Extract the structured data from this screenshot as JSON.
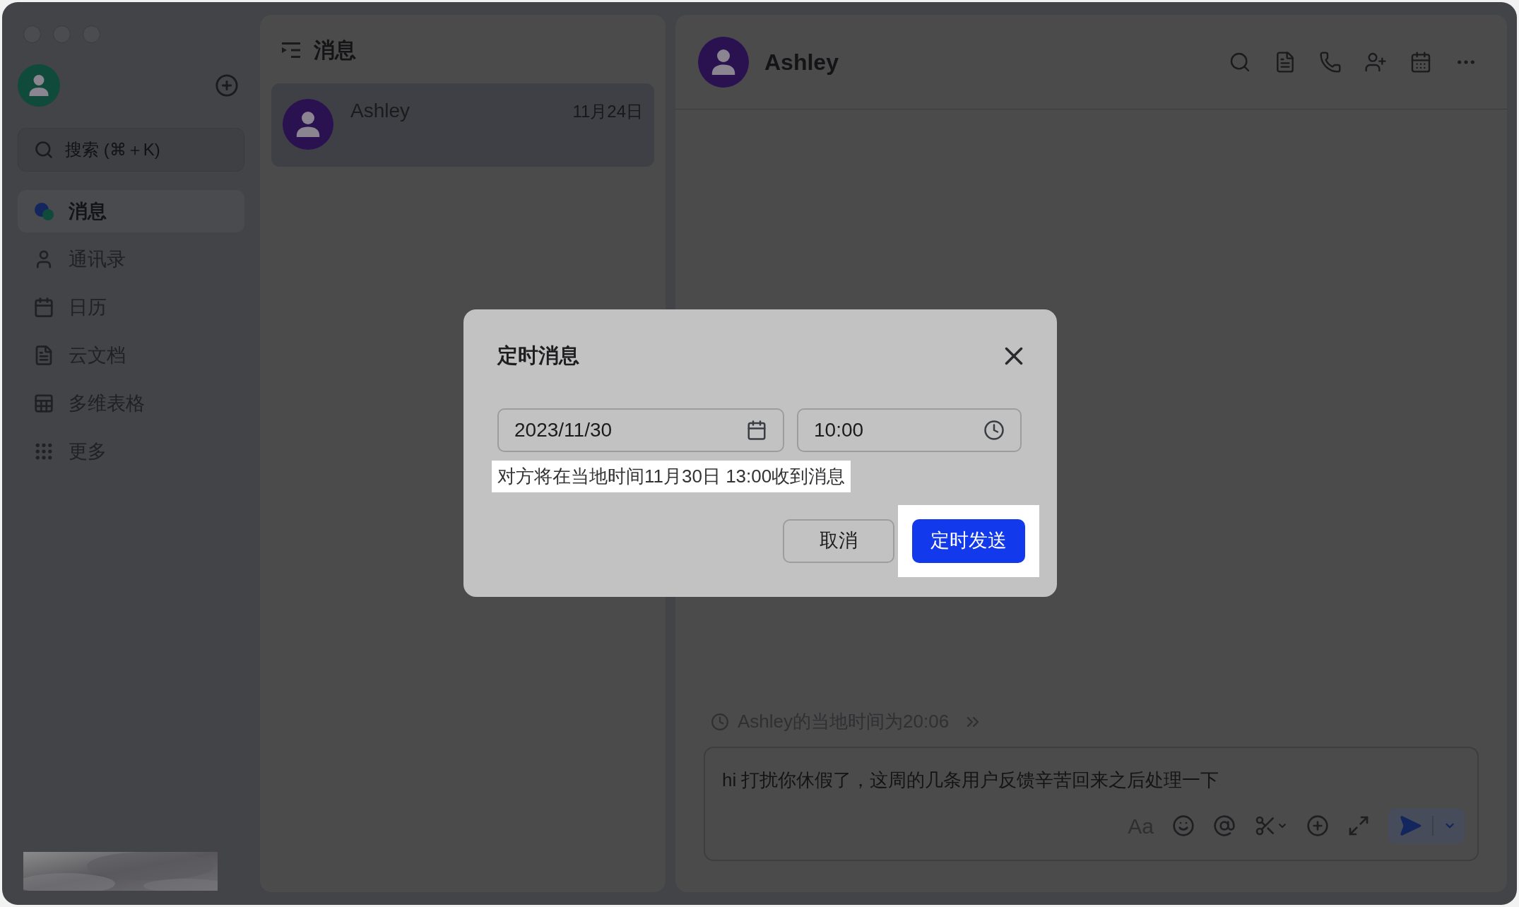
{
  "sidebar": {
    "search": {
      "placeholder": "搜索 (⌘＋K)"
    },
    "items": [
      {
        "label": "消息",
        "kind": "messages",
        "selected": true
      },
      {
        "label": "通讯录",
        "kind": "contacts",
        "selected": false
      },
      {
        "label": "日历",
        "kind": "calendar",
        "selected": false
      },
      {
        "label": "云文档",
        "kind": "docs",
        "selected": false
      },
      {
        "label": "多维表格",
        "kind": "base",
        "selected": false
      },
      {
        "label": "更多",
        "kind": "more",
        "selected": false
      }
    ]
  },
  "chat_list": {
    "title": "消息",
    "chats": [
      {
        "name": "Ashley",
        "date": "11月24日",
        "selected": true
      }
    ]
  },
  "chat": {
    "name": "Ashley",
    "local_time": "Ashley的当地时间为20:06",
    "draft": "hi 打扰你休假了，这周的几条用户反馈辛苦回来之后处理一下",
    "format_label": "Aa"
  },
  "dialog": {
    "title": "定时消息",
    "date": "2023/11/30",
    "time": "10:00",
    "hint": "对方将在当地时间11月30日 13:00收到消息",
    "cancel": "取消",
    "confirm": "定时发送"
  }
}
